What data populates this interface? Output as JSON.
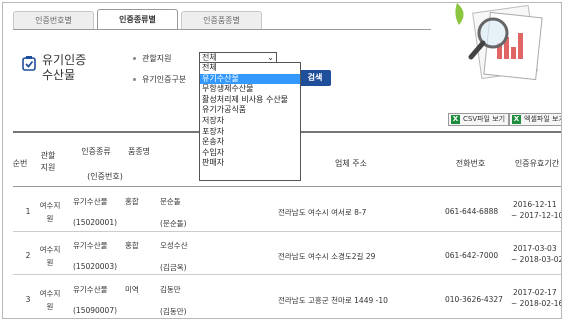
{
  "tabs": [
    "인증번호별",
    "인증종류별",
    "인증품종별"
  ],
  "title": "유기인증\n수산물",
  "filters": {
    "region_label": "관할지원",
    "type_label": "유기인증구분",
    "region_value": "전체",
    "type_options": [
      "전체",
      "유기수산물",
      "무항생제수산물",
      "활성처리제 비사용 수산물",
      "유기가공식품",
      "저장자",
      "포장자",
      "운송자",
      "수입자",
      "판매자"
    ],
    "type_selected": "유기수산물",
    "search_label": "검색"
  },
  "export": {
    "csv_label": "CSV파일 보기",
    "excel_label": "엑셀파일 보기",
    "icon": "excel-x-icon"
  },
  "table": {
    "headers": {
      "no": "순번",
      "region": "관할\n지원",
      "cert_type": "인증종류",
      "product": "품종명",
      "cert_no": "(인증번호)",
      "company": "업체 주소",
      "phone": "전화번호",
      "period": "인증유효기간"
    },
    "rows": [
      {
        "no": "1",
        "region": "여수지\n원",
        "cert_type": "유기수산물",
        "product": "홍합",
        "rep": "문순돌",
        "cert_no": "(15020001)",
        "rep2": "(문순돌)",
        "address": "전라남도 여수시 여서로 8-7",
        "phone": "061-644-6888",
        "start": "2016-12-11",
        "end": "~ 2017-12-10"
      },
      {
        "no": "2",
        "region": "여수지\n원",
        "cert_type": "유기수산물",
        "product": "홍합",
        "rep": "오성수산",
        "cert_no": "(15020003)",
        "rep2": "(김금옥)",
        "address": "전라남도 여수시 소경도2길 29",
        "phone": "061-642-7000",
        "start": "2017-03-03",
        "end": "~ 2018-03-02"
      },
      {
        "no": "3",
        "region": "여수지\n원",
        "cert_type": "유기수산물",
        "product": "미역",
        "rep": "김동만",
        "cert_no": "(15090007)",
        "rep2": "(김동만)",
        "address": "전라남도 고흥군 천마로 1449 -10",
        "phone": "010-3626-4327",
        "start": "2017-02-17",
        "end": "~ 2018-02-16"
      }
    ]
  }
}
